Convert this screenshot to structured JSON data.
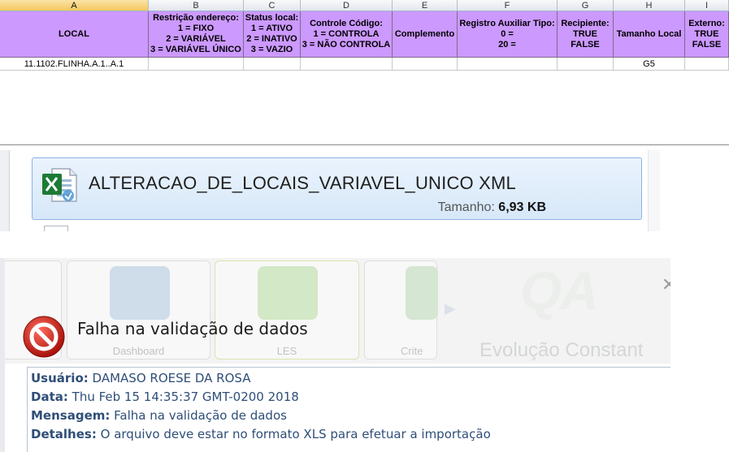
{
  "spreadsheet": {
    "column_letters": [
      "A",
      "B",
      "C",
      "D",
      "E",
      "F",
      "G",
      "H",
      "I"
    ],
    "headers": [
      "LOCAL",
      "Restrição endereço:\n1 = FIXO\n2 = VARIÁVEL\n3 = VARIÁVEL ÚNICO",
      "Status local:\n1 = ATIVO\n2 = INATIVO\n3 = VAZIO",
      "Controle Código:\n1 = CONTROLA\n3 = NÃO CONTROLA",
      "Complemento",
      "Registro Auxiliar Tipo:\n0 =\n20 =",
      "Recipiente:\nTRUE\nFALSE",
      "Tamanho Local",
      "Externo:\nTRUE\nFALSE"
    ],
    "rows": [
      [
        "11.1102.FLINHA.A.1..A.1",
        "",
        "",
        "",
        "",
        "",
        "",
        "G5",
        ""
      ]
    ],
    "header_color": "#cc99ff"
  },
  "file": {
    "name": "ALTERACAO_DE_LOCAIS_VARIAVEL_UNICO XML",
    "size_label": "Tamanho:",
    "size_value": "6,93 KB",
    "icon": "excel-file-icon"
  },
  "dialog": {
    "title": "Falha na validação de dados",
    "icon": "error-no-entry-icon",
    "background_tiles": [
      "Dashboard",
      "LES",
      "Crite"
    ],
    "logo_text": "QA",
    "logo_slogan": "Evolução Constant",
    "details": {
      "user_label": "Usuário:",
      "user_value": "DAMASO ROESE DA ROSA",
      "date_label": "Data:",
      "date_value": "Thu Feb 15 14:35:37 GMT-0200 2018",
      "message_label": "Mensagem:",
      "message_value": "Falha na validação de dados",
      "details_label": "Detalhes:",
      "details_value": "O arquivo deve estar no formato XLS para efetuar a importação"
    }
  }
}
